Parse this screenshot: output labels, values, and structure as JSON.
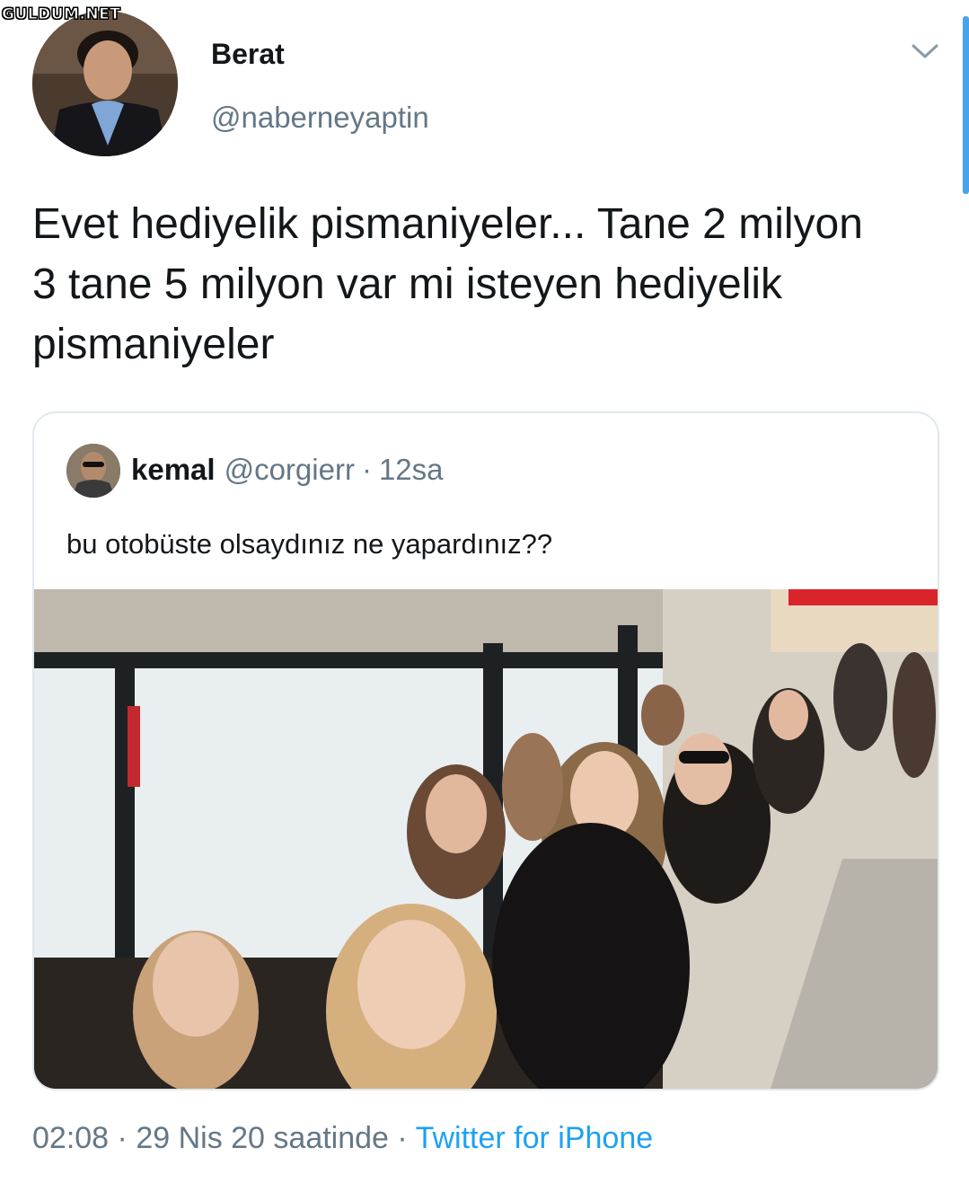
{
  "watermark": "GULDUM.NET",
  "tweet": {
    "author_name": "Berat",
    "author_handle": "@naberneyaptin",
    "text": "Evet hediyelik pismaniyeler... Tane 2 milyon 3 tane 5 milyon var mi isteyen hediyelik pismaniyeler",
    "time": "02:08",
    "separator": "·",
    "date": "29 Nis 20 saatinde",
    "source": "Twitter for iPhone"
  },
  "quoted": {
    "author_name": "kemal",
    "author_handle": "@corgierr",
    "separator": "·",
    "time_ago": "12sa",
    "text": "bu otobüste olsaydınız ne yapardınız??"
  },
  "icons": {
    "menu": "chevron-down-icon"
  },
  "colors": {
    "primary_text": "#14171a",
    "secondary_text": "#657786",
    "link": "#1da1f2",
    "border": "#e1e8ed"
  }
}
